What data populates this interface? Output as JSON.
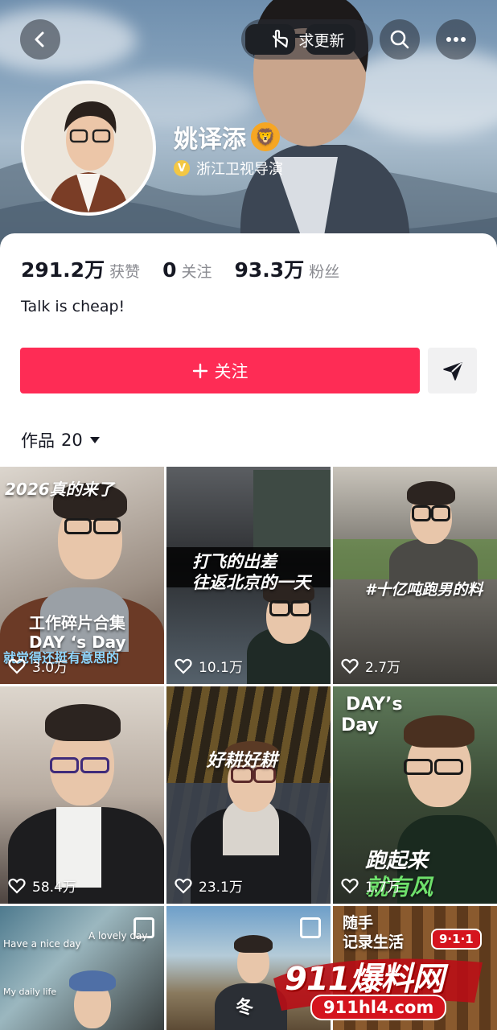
{
  "header": {
    "update_request_label": "求更新",
    "icons": [
      "back-icon",
      "hand-point-icon",
      "search-icon",
      "more-icon"
    ]
  },
  "profile": {
    "name": "姚译添",
    "verified_title": "浙江卫视导演",
    "bio": "Talk is cheap!"
  },
  "stats": [
    {
      "value": "291.2万",
      "label": "获赞"
    },
    {
      "value": "0",
      "label": "关注"
    },
    {
      "value": "93.3万",
      "label": "粉丝"
    }
  ],
  "actions": {
    "follow_label": "关注",
    "follow_color": "#fe2c55"
  },
  "works": {
    "label": "作品",
    "count": "20"
  },
  "videos": [
    {
      "likes": "3.0万",
      "captions": [
        "2026真的来了",
        "工作碎片合集",
        "DAY ‘s Day",
        "就觉得还挺有意思的"
      ]
    },
    {
      "likes": "10.1万",
      "captions": [
        "打飞的出差",
        "往返北京的一天"
      ]
    },
    {
      "likes": "2.7万",
      "captions": [
        "#十亿吨跑男的料"
      ]
    },
    {
      "likes": "58.4万",
      "captions": []
    },
    {
      "likes": "23.1万",
      "captions": [
        "好耕好耕"
      ]
    },
    {
      "likes": "1.7万",
      "captions": [
        "DAY’s",
        "Day",
        "跑起来",
        "就有风"
      ]
    },
    {
      "likes": "",
      "captions": [
        "Have a nice day",
        "A lovely day",
        "My daily life"
      ]
    },
    {
      "likes": "",
      "captions": [
        "冬"
      ]
    },
    {
      "likes": "",
      "captions": [
        "随手",
        "记录生活"
      ]
    }
  ],
  "watermark": {
    "main": "911爆料网",
    "sub": "911hl4.com",
    "badge": "9·1·1"
  }
}
